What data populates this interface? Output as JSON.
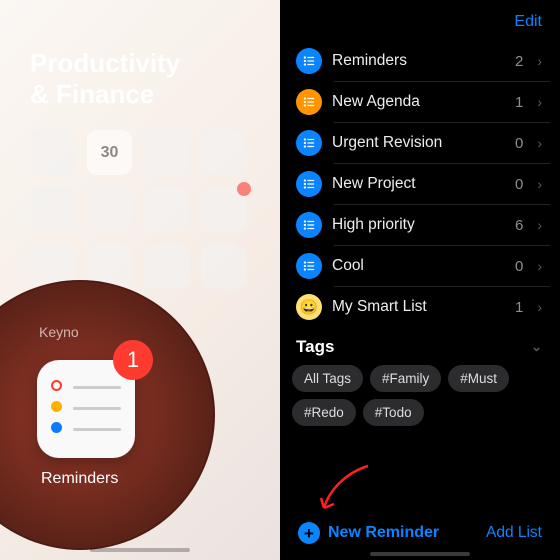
{
  "left": {
    "folder_title": "Productivity\n& Finance",
    "calendar_date": "30",
    "magnified": {
      "peek_label": "Keyno",
      "app_label": "Reminders",
      "badge_count": "1"
    }
  },
  "right": {
    "edit_label": "Edit",
    "lists": [
      {
        "name": "Reminders",
        "count": "2",
        "color": "blue"
      },
      {
        "name": "New Agenda",
        "count": "1",
        "color": "orange"
      },
      {
        "name": "Urgent Revision",
        "count": "0",
        "color": "blue"
      },
      {
        "name": "New Project",
        "count": "0",
        "color": "blue"
      },
      {
        "name": "High priority",
        "count": "6",
        "color": "blue"
      },
      {
        "name": "Cool",
        "count": "0",
        "color": "blue"
      },
      {
        "name": "My Smart List",
        "count": "1",
        "color": "smart"
      }
    ],
    "tags_header": "Tags",
    "tags": [
      "All Tags",
      "#Family",
      "#Must",
      "#Redo",
      "#Todo"
    ],
    "new_reminder_label": "New Reminder",
    "add_list_label": "Add List"
  }
}
